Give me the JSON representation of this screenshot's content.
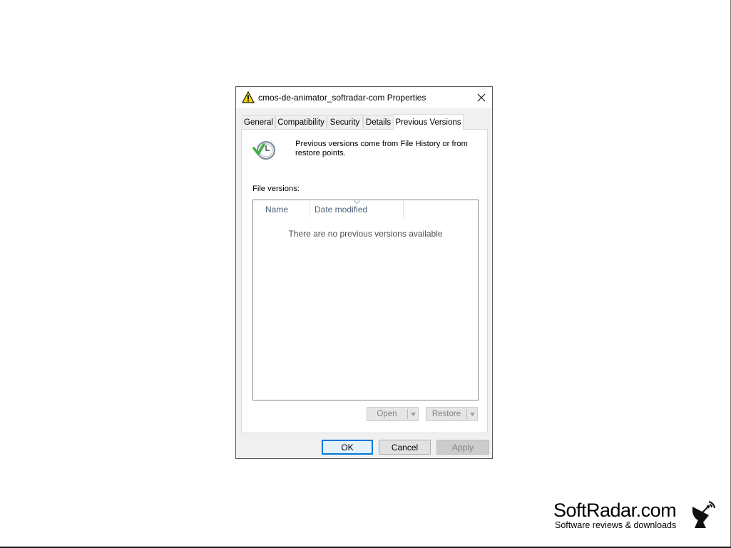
{
  "dialog": {
    "title": "cmos-de-animator_softradar-com Properties",
    "title_icon": "warning-triangle-icon",
    "close_icon": "close-icon"
  },
  "tabs": [
    {
      "label": "General"
    },
    {
      "label": "Compatibility"
    },
    {
      "label": "Security"
    },
    {
      "label": "Details"
    },
    {
      "label": "Previous Versions",
      "active": true
    }
  ],
  "panel": {
    "info_icon": "clock-restore-icon",
    "info_text": "Previous versions come from File History or from restore points.",
    "file_versions_label": "File versions:",
    "columns": [
      {
        "label": "Name"
      },
      {
        "label": "Date modified"
      }
    ],
    "empty_message": "There are no previous versions available",
    "open_label": "Open",
    "restore_label": "Restore"
  },
  "footer": {
    "ok_label": "OK",
    "cancel_label": "Cancel",
    "apply_label": "Apply"
  },
  "watermark": {
    "brand": "SoftRadar.com",
    "tagline": "Software reviews & downloads"
  },
  "colors": {
    "accent": "#0078d7",
    "header_text": "#4c607a"
  }
}
